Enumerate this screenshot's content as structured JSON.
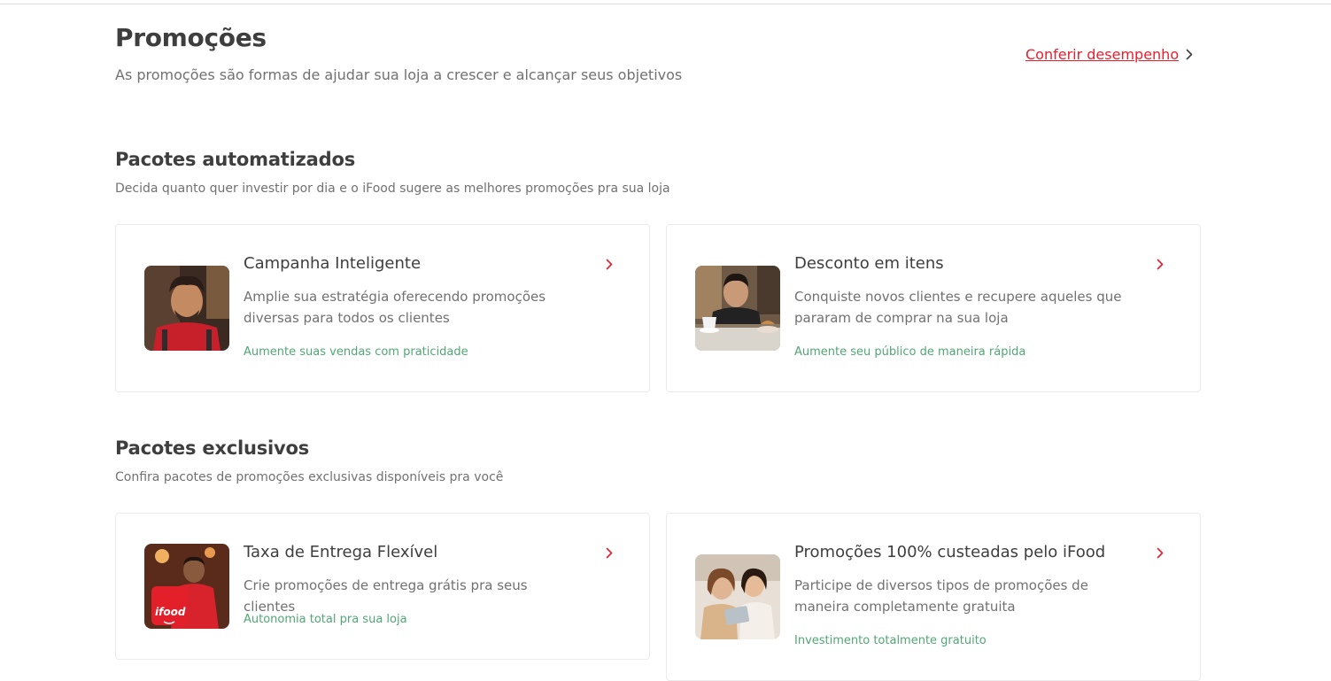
{
  "header": {
    "title": "Promoções",
    "subtitle": "As promoções são formas de ajudar sua loja a crescer e alcançar seus objetivos",
    "performance_link": "Conferir desempenho"
  },
  "sections": [
    {
      "title": "Pacotes automatizados",
      "subtitle": "Decida quanto quer investir por dia e o iFood sugere as melhores promoções pra sua loja",
      "cards": [
        {
          "title": "Campanha Inteligente",
          "description": "Amplie sua estratégia oferecendo promoções diversas para todos os clientes",
          "tag": "Aumente suas vendas com praticidade",
          "image": "smiling-man-red-apron-photo"
        },
        {
          "title": "Desconto em itens",
          "description": "Conquiste novos clientes e recupere aqueles que pararam de comprar na sua loja",
          "tag": "Aumente seu público de maneira rápida",
          "image": "barista-coffee-counter-photo"
        }
      ]
    },
    {
      "title": "Pacotes exclusivos",
      "subtitle": "Confira pacotes de promoções exclusivas disponíveis pra você",
      "cards": [
        {
          "title": "Taxa de Entrega Flexível",
          "description": "Crie promoções de entrega grátis pra seus clientes",
          "tag": "Autonomia total pra sua loja",
          "image": "ifood-delivery-person-photo",
          "image_text": "ifood"
        },
        {
          "title": "Promoções 100% custeadas pelo iFood",
          "description": "Participe de diversos tipos de promoções de maneira completamente gratuita",
          "tag": "Investimento totalmente gratuito",
          "image": "two-women-tablet-photo"
        }
      ]
    }
  ],
  "icons": {
    "chevron": "chevron-right-icon"
  },
  "colors": {
    "accent": "#ea1d2c",
    "tag": "#50a773",
    "text": "#3e3e3e",
    "muted": "#717171",
    "border": "#ebebeb"
  }
}
